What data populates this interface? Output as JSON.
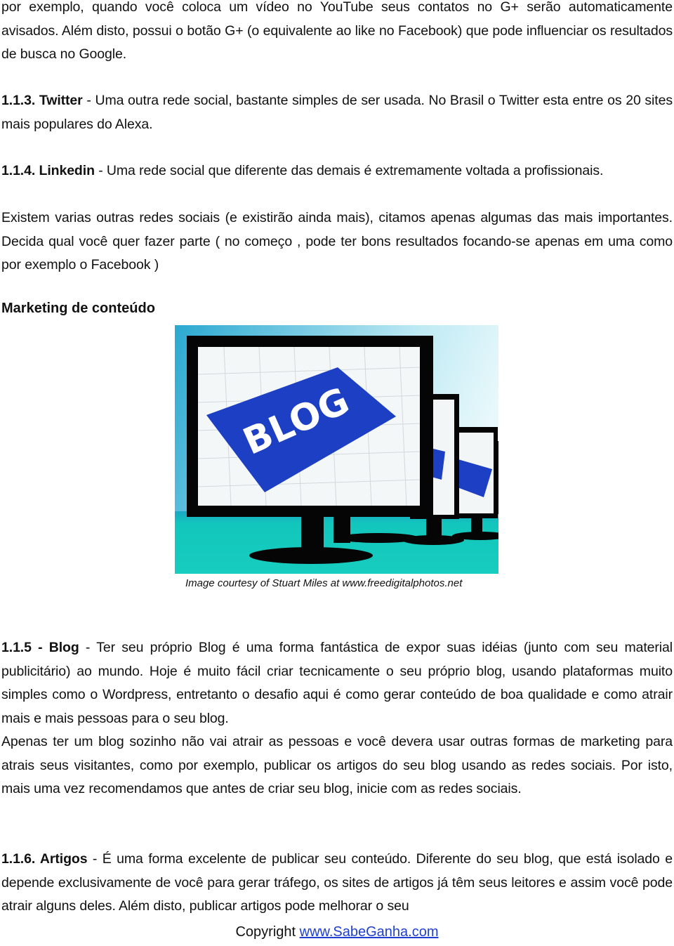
{
  "paragraphs": {
    "p_googleplus": "por exemplo, quando você coloca um vídeo no YouTube seus contatos no G+ serão automaticamente avisados. Além disto, possui o botão G+ (o equivalente ao like no Facebook) que pode influenciar os resultados de busca no Google.",
    "twitter": {
      "label": "1.1.3. Twitter",
      "text": " - Uma outra rede social, bastante simples de ser usada. No Brasil o Twitter esta entre os 20 sites mais populares do Alexa."
    },
    "linkedin": {
      "label": "1.1.4. Linkedin",
      "text": " - Uma rede social que diferente das demais é extremamente voltada a profissionais."
    },
    "p_others": "Existem varias outras redes sociais (e existirão ainda mais), citamos apenas algumas das mais importantes. Decida qual você quer fazer parte ( no começo , pode ter bons resultados focando-se apenas em uma como por exemplo o Facebook )",
    "blog": {
      "label": "1.1.5 - Blog",
      "text": " - Ter seu próprio Blog é uma forma fantástica de expor suas idéias (junto com seu material publicitário) ao mundo. Hoje é muito fácil criar tecnicamente o seu próprio blog, usando plataformas muito simples como o Wordpress, entretanto o desafio aqui é como gerar conteúdo de boa qualidade e como atrair mais e mais pessoas para o seu blog."
    },
    "p_blog_more": "Apenas ter um blog sozinho não vai atrair as pessoas e você devera usar outras formas de marketing para atrais seus visitantes, como por exemplo, publicar os artigos do seu blog usando as redes sociais. Por isto, mais uma vez recomendamos que antes de criar seu blog, inicie com as redes sociais.",
    "artigos": {
      "label": "1.1.6. Artigos",
      "text": " - É uma forma excelente de publicar seu conteúdo. Diferente do seu blog, que está isolado e depende exclusivamente de você para gerar tráfego, os sites de artigos já têm seus leitores e assim você pode atrair alguns deles.  Além disto, publicar artigos pode melhorar o seu"
    }
  },
  "section_heading": "Marketing de conteúdo",
  "figure": {
    "image_text": "BLOG",
    "caption": "Image courtesy of Stuart Miles at  www.freedigitalphotos.net",
    "colors": {
      "sky": "#3ab7d8",
      "floor": "#19c7b8",
      "blog_blue": "#1c3fc4",
      "monitor": "#050505"
    }
  },
  "footer": {
    "prefix": "Copyright ",
    "link_text": "www.SabeGanha.com",
    "link_color": "#1f3fd0"
  }
}
